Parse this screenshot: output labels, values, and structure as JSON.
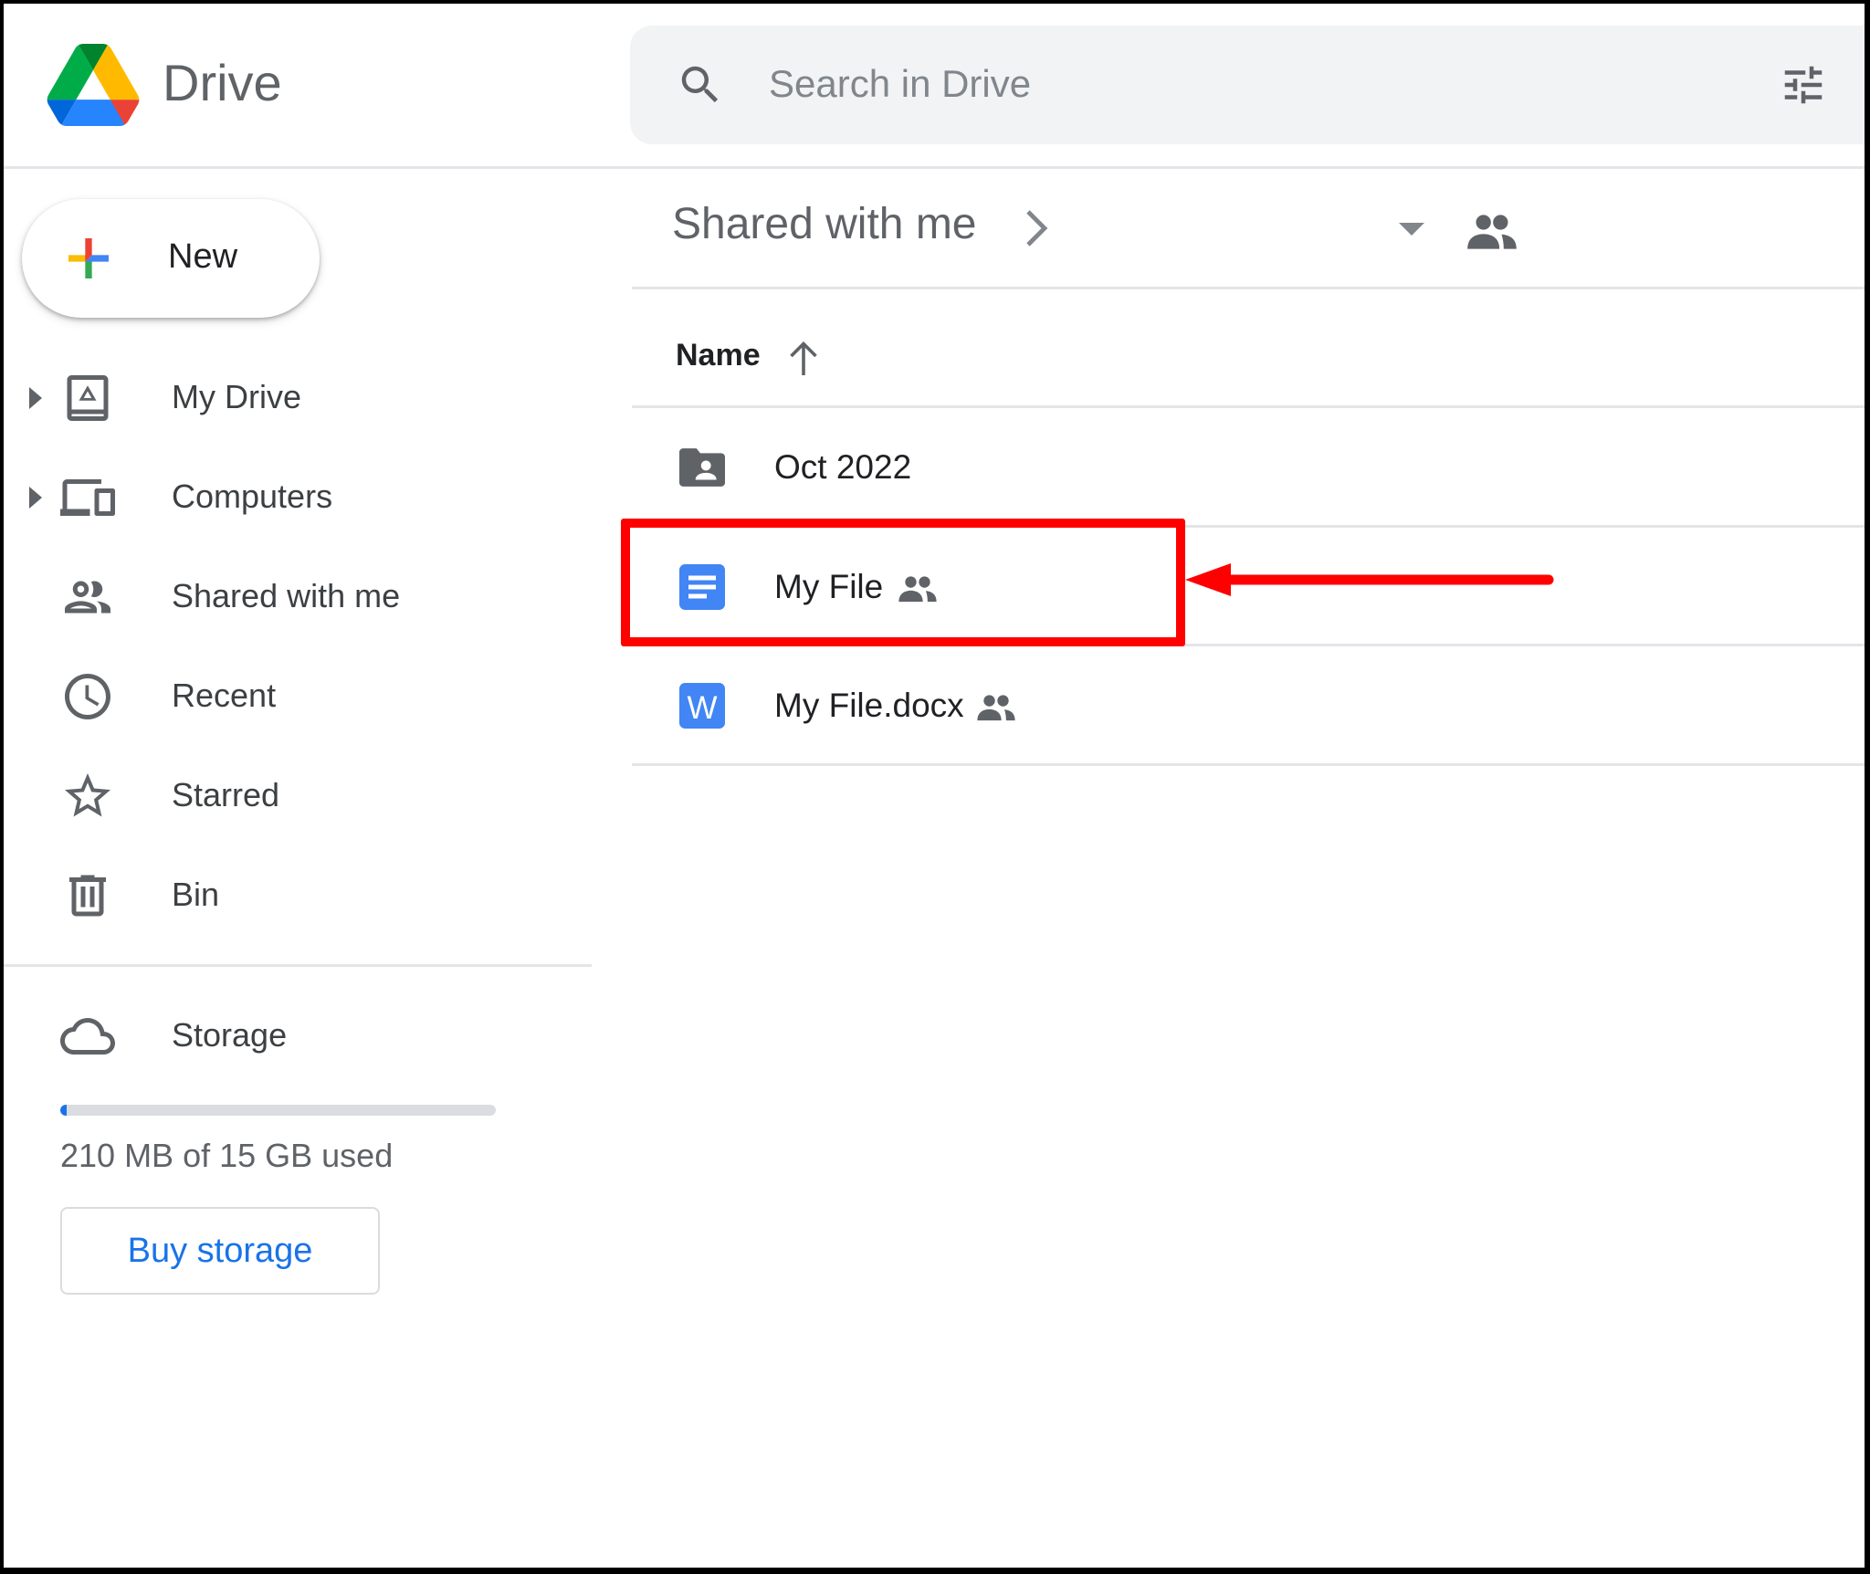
{
  "header": {
    "app_title": "Drive",
    "logo_icon": "google-drive-logo",
    "search": {
      "placeholder": "Search in Drive",
      "value": "",
      "icon": "search-icon",
      "options_icon": "tune-icon"
    }
  },
  "sidebar": {
    "new_button": {
      "label": "New",
      "icon": "plus-icon"
    },
    "items": [
      {
        "label": "My Drive",
        "icon": "my-drive-icon",
        "expandable": true
      },
      {
        "label": "Computers",
        "icon": "computers-icon",
        "expandable": true
      },
      {
        "label": "Shared with me",
        "icon": "shared-people-icon",
        "expandable": false
      },
      {
        "label": "Recent",
        "icon": "clock-icon",
        "expandable": false
      },
      {
        "label": "Starred",
        "icon": "star-icon",
        "expandable": false
      },
      {
        "label": "Bin",
        "icon": "trash-icon",
        "expandable": false
      }
    ],
    "storage": {
      "label": "Storage",
      "icon": "cloud-icon",
      "used_text": "210 MB of 15 GB used",
      "used_fraction": 0.014,
      "buy_label": "Buy storage"
    }
  },
  "main": {
    "breadcrumb": {
      "title": "Shared with me",
      "chevron_icon": "chevron-right-icon",
      "dropdown_icon": "arrow-drop-down-icon",
      "people_icon": "people-icon"
    },
    "columns": [
      {
        "label": "Name",
        "sort": "ascending",
        "sort_icon": "arrow-up-icon"
      }
    ],
    "files": [
      {
        "name": "Oct 2022",
        "type": "shared-folder",
        "icon": "shared-folder-icon",
        "shared": false
      },
      {
        "name": "My File",
        "type": "google-doc",
        "icon": "google-docs-icon",
        "shared": true,
        "highlighted": true
      },
      {
        "name": "My File.docx",
        "type": "word-doc",
        "icon": "word-doc-icon",
        "icon_letter": "W",
        "shared": true
      }
    ]
  },
  "annotation": {
    "type": "highlight-box-with-arrow",
    "target": "My File",
    "color": "#ff0000"
  },
  "colors": {
    "accent_blue": "#1a73e8",
    "docs_blue": "#4285f4",
    "text_gray": "#5f6368",
    "annotation_red": "#ff0000"
  }
}
